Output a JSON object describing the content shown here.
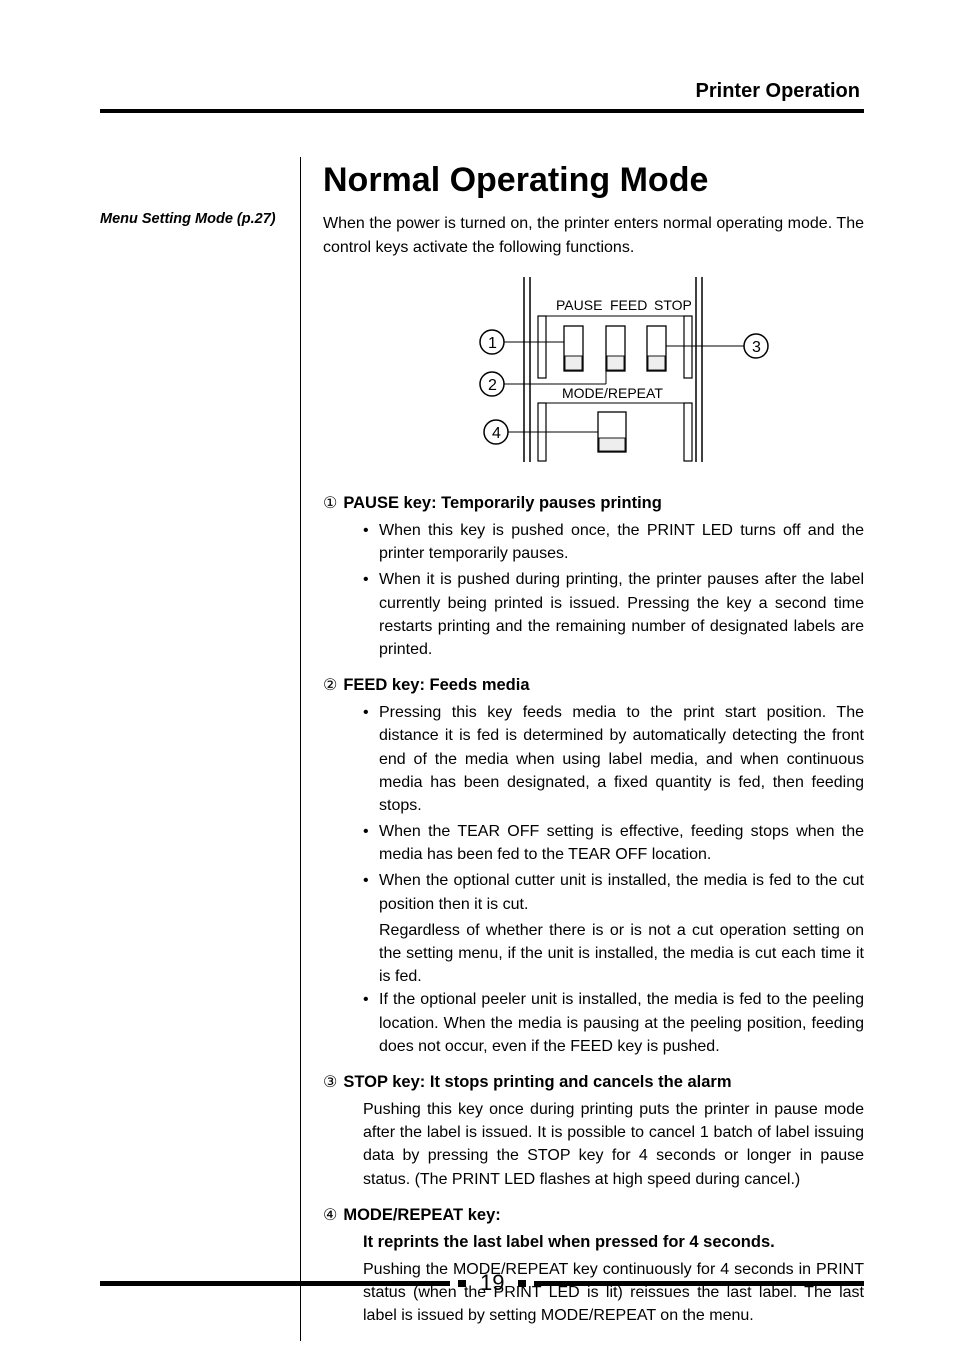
{
  "header": {
    "title": "Printer Operation"
  },
  "sidebar": {
    "menu_ref": "Menu Setting Mode (p.27)"
  },
  "main": {
    "title": "Normal Operating Mode",
    "intro": "When the power is turned on, the printer enters normal operating mode. The control keys activate the following functions."
  },
  "diagram": {
    "labels": {
      "pause": "PAUSE",
      "feed": "FEED",
      "stop": "STOP",
      "mode_repeat": "MODE/REPEAT"
    },
    "callouts": {
      "one": "1",
      "two": "2",
      "three": "3",
      "four": "4"
    }
  },
  "sections": {
    "pause": {
      "num": "①",
      "title": "PAUSE key: Temporarily pauses printing",
      "bullets": [
        "When this key is pushed once, the PRINT LED turns off and the printer temporarily pauses.",
        "When it is pushed during printing, the printer pauses after the label currently being printed is issued. Pressing the key a second time restarts printing and the remaining number of designated labels are printed."
      ]
    },
    "feed": {
      "num": "②",
      "title": "FEED key: Feeds media",
      "bullets": [
        "Pressing this key feeds media to the print start position. The distance it is fed is determined by automatically detecting the front end of the media when using label media, and when continuous media has been designated, a fixed quantity is fed, then feeding stops.",
        "When the TEAR OFF setting is effective, feeding stops when the media has been fed to the TEAR OFF location.",
        "When the optional cutter unit is installed, the media is fed to the cut position then it is cut.",
        "If the optional peeler unit is installed, the media is fed to the peeling location. When the media is pausing at the peeling position, feeding does not occur, even if the FEED key is pushed."
      ],
      "extra_after_bullet3": "Regardless of whether there is or is not a cut operation setting on the setting menu, if the unit is installed, the media is cut each time it is fed."
    },
    "stop": {
      "num": "③",
      "title": "STOP key: It stops printing and cancels the alarm",
      "para": "Pushing this key once during printing puts the printer in pause mode after the label is issued. It is possible to cancel 1 batch of label issuing data by pressing the STOP key for 4 seconds or longer in pause status. (The PRINT LED flashes at high speed during cancel.)"
    },
    "mode": {
      "num": "④",
      "title": "MODE/REPEAT key:",
      "subtitle": "It reprints the last label when pressed for 4 seconds.",
      "para": "Pushing the MODE/REPEAT key continuously for 4 seconds in PRINT status (when the PRINT LED is lit) reissues the last label. The last label is issued by setting MODE/REPEAT on the menu."
    }
  },
  "footer": {
    "page": "19"
  }
}
